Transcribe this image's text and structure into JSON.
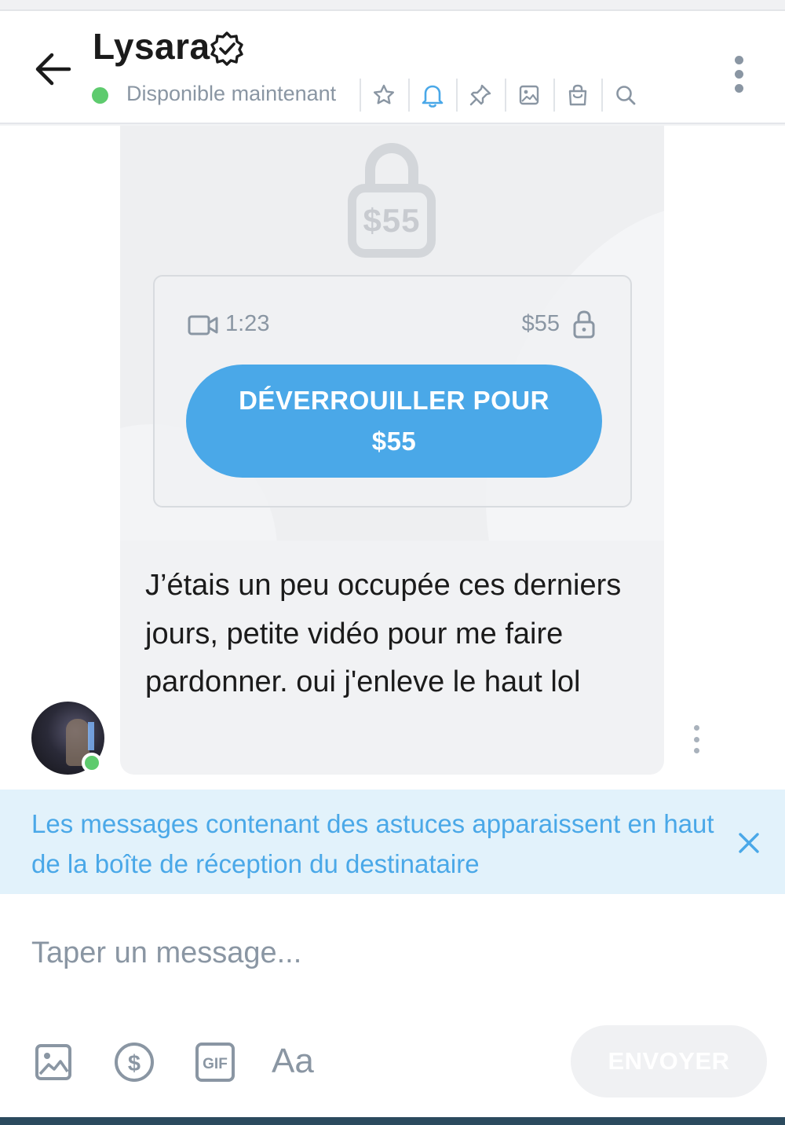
{
  "header": {
    "name": "Lysara",
    "status": "Disponible maintenant",
    "icons": [
      "star-icon",
      "bell-icon",
      "pin-icon",
      "image-icon",
      "bag-icon",
      "search-icon"
    ]
  },
  "message": {
    "locked_price": "$55",
    "duration": "1:23",
    "card_price": "$55",
    "unlock_line1": "DÉVERROUILLER POUR",
    "unlock_line2": "$55",
    "text": "J’étais un peu occupée ces derniers jours, petite vidéo pour me faire pardonner. oui j'enleve le haut lol"
  },
  "banner": {
    "text": "Les messages contenant des astuces apparaissent en haut de la boîte de réception du destinataire"
  },
  "compose": {
    "placeholder": "Taper un message...",
    "font_label": "Aa",
    "send_label": "ENVOYER"
  },
  "colors": {
    "accent": "#4aa8e8",
    "online": "#5ecb6e",
    "muted": "#8a96a3",
    "banner_bg": "#e2f2fb"
  }
}
